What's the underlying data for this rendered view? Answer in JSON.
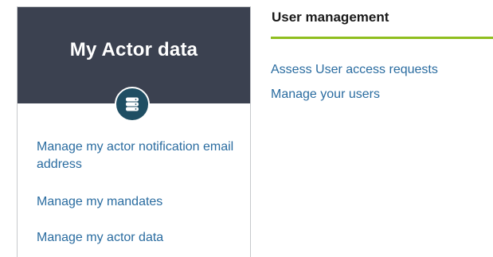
{
  "actor_card": {
    "title": "My Actor data",
    "icon": "database-icon",
    "links": [
      "Manage my actor notification email address",
      "Manage my mandates",
      "Manage my actor data"
    ]
  },
  "user_management": {
    "title": "User management",
    "links": [
      "Assess User access requests",
      "Manage your users"
    ]
  },
  "colors": {
    "card_header": "#3b4150",
    "icon_bg": "#1f4e63",
    "link": "#2a6ca0",
    "accent_rule": "#8fbe1f"
  }
}
